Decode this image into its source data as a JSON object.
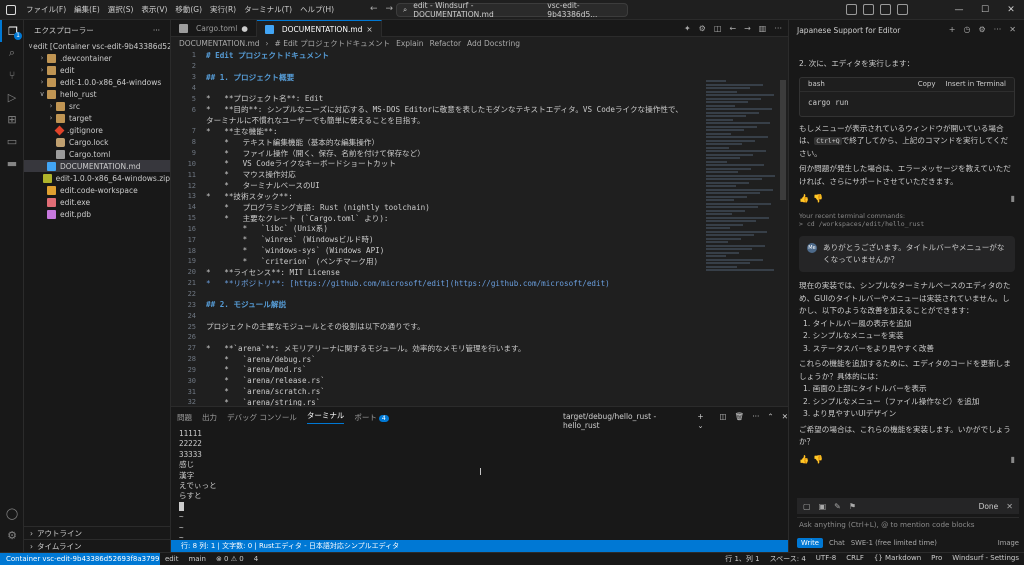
{
  "titlebar": {
    "menu": [
      "ファイル(F)",
      "編集(E)",
      "選択(S)",
      "表示(V)",
      "移動(G)",
      "実行(R)",
      "ターミナル(T)",
      "ヘルプ(H)"
    ],
    "search": "edit - Windsurf - DOCUMENTATION.md",
    "context": "vsc-edit-9b43386d5..."
  },
  "sidebar": {
    "title": "エクスプローラー",
    "tree": [
      {
        "label": "edit [Container vsc-edit-9b43386d52693f...",
        "indent": 0,
        "chev": "∨",
        "icon": "none"
      },
      {
        "label": ".devcontainer",
        "indent": 1,
        "chev": "›",
        "icon": "folder"
      },
      {
        "label": "edit",
        "indent": 1,
        "chev": "›",
        "icon": "folder"
      },
      {
        "label": "edit-1.0.0-x86_64-windows",
        "indent": 1,
        "chev": "›",
        "icon": "folder"
      },
      {
        "label": "hello_rust",
        "indent": 1,
        "chev": "∨",
        "icon": "folder"
      },
      {
        "label": "src",
        "indent": 2,
        "chev": "›",
        "icon": "folder"
      },
      {
        "label": "target",
        "indent": 2,
        "chev": "›",
        "icon": "folder"
      },
      {
        "label": ".gitignore",
        "indent": 2,
        "chev": "",
        "icon": "git"
      },
      {
        "label": "Cargo.lock",
        "indent": 2,
        "chev": "",
        "icon": "lock"
      },
      {
        "label": "Cargo.toml",
        "indent": 2,
        "chev": "",
        "icon": "toml"
      },
      {
        "label": "DOCUMENTATION.md",
        "indent": 1,
        "chev": "",
        "icon": "md",
        "selected": true
      },
      {
        "label": "edit-1.0.0-x86_64-windows.zip",
        "indent": 1,
        "chev": "",
        "icon": "zip"
      },
      {
        "label": "edit.code-workspace",
        "indent": 1,
        "chev": "",
        "icon": "code"
      },
      {
        "label": "edit.exe",
        "indent": 1,
        "chev": "",
        "icon": "exe"
      },
      {
        "label": "edit.pdb",
        "indent": 1,
        "chev": "",
        "icon": "pdb"
      }
    ],
    "outline": "アウトライン",
    "timeline": "タイムライン"
  },
  "editor": {
    "tabs": [
      {
        "label": "Cargo.toml",
        "suffix": "●",
        "active": false
      },
      {
        "label": "DOCUMENTATION.md",
        "suffix": "×",
        "active": true
      }
    ],
    "breadcrumb": [
      "DOCUMENTATION.md",
      "# Edit プロジェクトドキュメント",
      "Explain",
      "Refactor",
      "Add Docstring"
    ],
    "lines": [
      {
        "n": "1",
        "t": "# Edit プロジェクトドキュメント",
        "k": "h"
      },
      {
        "n": "2",
        "t": "",
        "k": ""
      },
      {
        "n": "3",
        "t": "## 1. プロジェクト概要",
        "k": "h"
      },
      {
        "n": "4",
        "t": "",
        "k": ""
      },
      {
        "n": "5",
        "t": "*   **プロジェクト名**: Edit",
        "k": ""
      },
      {
        "n": "6",
        "t": "*   **目的**: シンプルなニーズに対応する、MS-DOS Editorに敬意を表したモダンなテキストエディタ。VS Codeライクな操作性で、",
        "k": ""
      },
      {
        "n": "",
        "t": "ターミナルに不慣れなユーザーでも簡単に使えることを目指す。",
        "k": ""
      },
      {
        "n": "7",
        "t": "*   **主な機能**:",
        "k": ""
      },
      {
        "n": "8",
        "t": "    *   テキスト編集機能（基本的な編集操作）",
        "k": ""
      },
      {
        "n": "9",
        "t": "    *   ファイル操作（開く、保存、名前を付けて保存など）",
        "k": ""
      },
      {
        "n": "10",
        "t": "    *   VS Codeライクなキーボードショートカット",
        "k": ""
      },
      {
        "n": "11",
        "t": "    *   マウス操作対応",
        "k": ""
      },
      {
        "n": "12",
        "t": "    *   ターミナルベースのUI",
        "k": ""
      },
      {
        "n": "13",
        "t": "*   **技術スタック**:",
        "k": ""
      },
      {
        "n": "14",
        "t": "    *   プログラミング言語: Rust (nightly toolchain)",
        "k": ""
      },
      {
        "n": "15",
        "t": "    *   主要なクレート (`Cargo.toml` より):",
        "k": ""
      },
      {
        "n": "16",
        "t": "        *   `libc` (Unix系)",
        "k": ""
      },
      {
        "n": "17",
        "t": "        *   `winres` (Windowsビルド時)",
        "k": ""
      },
      {
        "n": "18",
        "t": "        *   `windows-sys` (Windows API)",
        "k": ""
      },
      {
        "n": "19",
        "t": "        *   `criterion` (ベンチマーク用)",
        "k": ""
      },
      {
        "n": "20",
        "t": "*   **ライセンス**: MIT License",
        "k": ""
      },
      {
        "n": "21",
        "t": "*   **リポジトリ**: [https://github.com/microsoft/edit](https://github.com/microsoft/edit)",
        "k": "l"
      },
      {
        "n": "22",
        "t": "",
        "k": ""
      },
      {
        "n": "23",
        "t": "## 2. モジュール解説",
        "k": "h"
      },
      {
        "n": "24",
        "t": "",
        "k": ""
      },
      {
        "n": "25",
        "t": "プロジェクトの主要なモジュールとその役割は以下の通りです。",
        "k": ""
      },
      {
        "n": "26",
        "t": "",
        "k": ""
      },
      {
        "n": "27",
        "t": "*   **`arena`**: メモリアリーナに関するモジュール。効率的なメモリ管理を行います。",
        "k": ""
      },
      {
        "n": "28",
        "t": "    *   `arena/debug.rs`",
        "k": ""
      },
      {
        "n": "29",
        "t": "    *   `arena/mod.rs`",
        "k": ""
      },
      {
        "n": "30",
        "t": "    *   `arena/release.rs`",
        "k": ""
      },
      {
        "n": "31",
        "t": "    *   `arena/scratch.rs`",
        "k": ""
      },
      {
        "n": "32",
        "t": "    *   `arena/string.rs`",
        "k": ""
      }
    ]
  },
  "panel": {
    "tabs": [
      {
        "label": "問題",
        "active": false
      },
      {
        "label": "出力",
        "active": false
      },
      {
        "label": "デバッグ コンソール",
        "active": false
      },
      {
        "label": "ターミナル",
        "active": true
      },
      {
        "label": "ポート",
        "active": false
      }
    ],
    "ports_badge": "4",
    "terminal_name": "target/debug/hello_rust - hello_rust",
    "terminal_lines": [
      "11111",
      "22222",
      "33333",
      "感じ",
      "漢字",
      "えでぃっと",
      "らすと",
      "",
      "~",
      "~",
      "~"
    ],
    "status_line": "行: 8 列: 1 | 文字数: 0 | Rustエディタ - 日本語対応シンプルエディタ"
  },
  "chat": {
    "title": "Japanese Support for Editor",
    "step2": "2.  次に、エディタを実行します：",
    "code_lang": "bash",
    "code_copy": "Copy",
    "code_insert": "Insert in Terminal",
    "code_cmd": "cargo run",
    "p1a": "もしメニューが表示されているウィンドウが開いている場合は、",
    "p1_kbd": "Ctrl+Q",
    "p1b": "で終了してから、上記のコマンドを実行してください。",
    "p2": "何か問題が発生した場合は、エラーメッセージを教えていただければ、さらにサポートさせていただきます。",
    "recent_label": "Your recent terminal commands:",
    "recent_cmd": "> cd /workspaces/edit/hello_rust",
    "user_msg": "ありがとうございます。タイトルバーやメニューがなくなっていませんか？",
    "p3": "現在の実装では、シンプルなターミナルベースのエディタのため、GUIのタイトルバーやメニューは実装されていません。しかし、以下のような改善を加えることができます：",
    "list1": [
      "1.  タイトルバー風の表示を追加",
      "2.  シンプルなメニューを実装",
      "3.  ステータスバーをより見やすく改善"
    ],
    "p4": "これらの機能を追加するために、エディタのコードを更新しましょうか？具体的には：",
    "list2": [
      "1.  画面の上部にタイトルバーを表示",
      "2.  シンプルなメニュー（ファイル操作など）を追加",
      "3.  より見やすいUIデザイン"
    ],
    "p5": "ご希望の場合は、これらの機能を実装します。いかがでしょうか？",
    "done": "Done",
    "input_placeholder": "Ask anything (Ctrl+L), @ to mention code blocks",
    "mode_write": "Write",
    "mode_chat": "Chat",
    "model": "SWE-1 (free limited time)",
    "image": "Image"
  },
  "statusbar": {
    "remote": "Container vsc-edit-9b43386d52693f8a37999...",
    "items_left": [
      "edit",
      "main",
      "⊗ 0 ⚠ 0",
      "4"
    ],
    "items_right": [
      "行 1、列 1",
      "スペース: 4",
      "UTF-8",
      "CRLF",
      "{} Markdown",
      "Pro",
      "Windsurf - Settings"
    ]
  },
  "colors": {
    "accent": "#0078d4",
    "heading": "#569cd6"
  }
}
